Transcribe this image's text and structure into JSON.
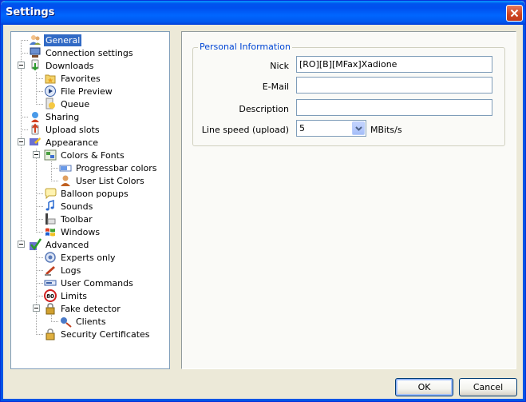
{
  "window": {
    "title": "Settings"
  },
  "tree": {
    "items": [
      {
        "label": "General",
        "icon": "users-icon",
        "level": 0,
        "selected": true
      },
      {
        "label": "Connection settings",
        "icon": "network-icon",
        "level": 0
      },
      {
        "label": "Downloads",
        "icon": "download-icon",
        "level": 0,
        "expanded": true
      },
      {
        "label": "Favorites",
        "icon": "favorites-folder-icon",
        "level": 1
      },
      {
        "label": "File Preview",
        "icon": "play-icon",
        "level": 1
      },
      {
        "label": "Queue",
        "icon": "queue-icon",
        "level": 1
      },
      {
        "label": "Sharing",
        "icon": "sharing-icon",
        "level": 0
      },
      {
        "label": "Upload slots",
        "icon": "upload-icon",
        "level": 0
      },
      {
        "label": "Appearance",
        "icon": "appearance-icon",
        "level": 0,
        "expanded": true
      },
      {
        "label": "Colors & Fonts",
        "icon": "colors-icon",
        "level": 1,
        "expanded": true
      },
      {
        "label": "Progressbar colors",
        "icon": "progressbar-icon",
        "level": 2
      },
      {
        "label": "User List Colors",
        "icon": "user-icon",
        "level": 2
      },
      {
        "label": "Balloon popups",
        "icon": "balloon-icon",
        "level": 1
      },
      {
        "label": "Sounds",
        "icon": "music-note-icon",
        "level": 1
      },
      {
        "label": "Toolbar",
        "icon": "toolbar-icon",
        "level": 1
      },
      {
        "label": "Windows",
        "icon": "windows-logo-icon",
        "level": 1
      },
      {
        "label": "Advanced",
        "icon": "checkmark-icon",
        "level": 0,
        "expanded": true
      },
      {
        "label": "Experts only",
        "icon": "expert-icon",
        "level": 1
      },
      {
        "label": "Logs",
        "icon": "logs-icon",
        "level": 1
      },
      {
        "label": "User Commands",
        "icon": "commands-icon",
        "level": 1
      },
      {
        "label": "Limits",
        "icon": "speed-limit-icon",
        "level": 1
      },
      {
        "label": "Fake detector",
        "icon": "lock-icon",
        "level": 1,
        "expanded": true
      },
      {
        "label": "Clients",
        "icon": "clients-icon",
        "level": 2
      },
      {
        "label": "Security Certificates",
        "icon": "certificate-lock-icon",
        "level": 1
      }
    ]
  },
  "personal_info": {
    "legend": "Personal Information",
    "nick_label": "Nick",
    "nick_value": "[RO][B][MFax]Xadione",
    "email_label": "E-Mail",
    "email_value": "",
    "description_label": "Description",
    "description_value": "",
    "line_speed_label": "Line speed (upload)",
    "line_speed_value": "5",
    "line_speed_units": "MBits/s"
  },
  "buttons": {
    "ok": "OK",
    "cancel": "Cancel"
  },
  "colors": {
    "accent": "#316ac5",
    "titlebar": "#0058ee",
    "legend": "#0046d5"
  }
}
